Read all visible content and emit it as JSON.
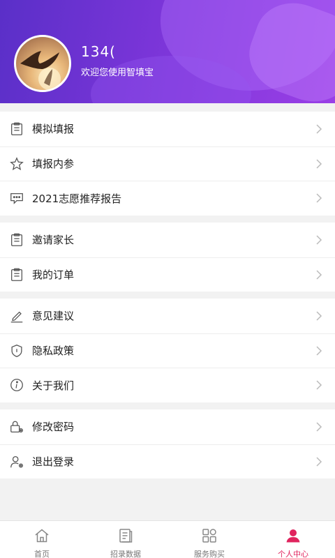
{
  "profile": {
    "username": "134(",
    "welcome": "欢迎您使用智填宝"
  },
  "groups": [
    {
      "items": [
        {
          "label": "模拟填报",
          "icon": "clipboard-icon"
        },
        {
          "label": "填报内参",
          "icon": "star-icon"
        },
        {
          "label": "2021志愿推荐报告",
          "icon": "chat-icon"
        }
      ]
    },
    {
      "items": [
        {
          "label": "邀请家长",
          "icon": "clipboard-icon"
        },
        {
          "label": "我的订单",
          "icon": "clipboard-icon"
        }
      ]
    },
    {
      "items": [
        {
          "label": "意见建议",
          "icon": "pencil-icon"
        },
        {
          "label": "隐私政策",
          "icon": "shield-icon"
        },
        {
          "label": "关于我们",
          "icon": "info-icon"
        }
      ]
    },
    {
      "items": [
        {
          "label": "修改密码",
          "icon": "lock-gear-icon"
        },
        {
          "label": "退出登录",
          "icon": "user-gear-icon"
        }
      ]
    }
  ],
  "tabbar": {
    "tabs": [
      {
        "label": "首页",
        "icon": "home-icon"
      },
      {
        "label": "招录数据",
        "icon": "document-icon"
      },
      {
        "label": "服务购买",
        "icon": "grid-icon"
      },
      {
        "label": "个人中心",
        "icon": "person-icon"
      }
    ],
    "active_index": 3
  },
  "colors": {
    "header_start": "#5a2fc8",
    "header_end": "#9a3fe6",
    "active_tab": "#e0245e"
  }
}
